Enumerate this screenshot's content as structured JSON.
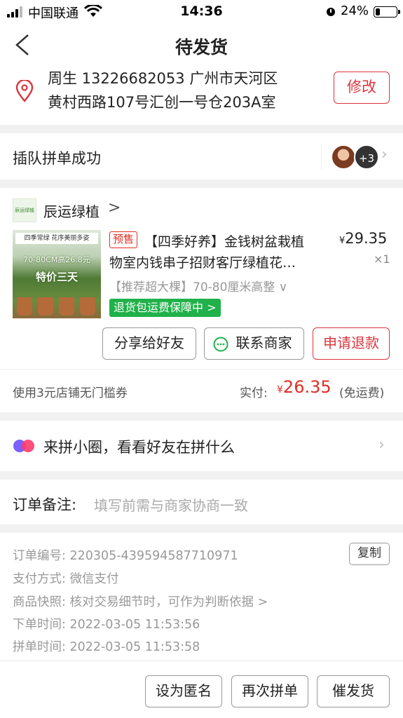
{
  "status_bar": {
    "carrier": "中国联通",
    "time": "14:36",
    "battery_percent": "24%",
    "battery_level": 0.24
  },
  "header": {
    "title": "待发货"
  },
  "address": {
    "name_phone_city": "周生  13226682053  广州市天河区",
    "detail": "黄村西路107号汇创一号仓203A室",
    "modify_label": "修改"
  },
  "group": {
    "label": "插队拼单成功",
    "extra_count": "+3"
  },
  "store": {
    "logo_text": "辰运绿植",
    "name": "辰运绿植",
    "arrow": ">"
  },
  "product": {
    "image_caption_top": "四季常绿  花序美丽多姿",
    "image_caption_mid": "70-80CM高26.8元",
    "image_caption_big": "特价三天",
    "presale_tag": "预售",
    "title_line1": "【四季好养】金钱树盆栽植",
    "title_line2": "物室内钱串子招财客厅绿植花…",
    "currency": "¥",
    "price": "29.35",
    "quantity": "×1",
    "spec": "【推荐超大棵】70-80厘米高整 ∨",
    "guarantee": "退货包运费保障中 >"
  },
  "actions": {
    "share": "分享给好友",
    "contact": "联系商家",
    "refund": "申请退款"
  },
  "payment": {
    "coupon": "使用3元店铺无门槛券",
    "paid_label": "实付:",
    "currency": "¥",
    "paid_amount": "26.35",
    "shipping": "(免运费)"
  },
  "circle": {
    "label": "来拼小圈，看看好友在拼什么"
  },
  "remark": {
    "label": "订单备注:",
    "placeholder": "填写前需与商家协商一致"
  },
  "order_info": {
    "order_no": "订单编号:  220305-439594587710971",
    "copy_label": "复制",
    "pay_method": "支付方式:  微信支付",
    "snapshot": "商品快照:  核对交易细节时，可作为判断依据 >",
    "order_time": "下单时间:  2022-03-05 11:53:56",
    "group_time": "拼单时间:  2022-03-05 11:53:58"
  },
  "bottom_bar": {
    "anonymous": "设为匿名",
    "regroup": "再次拼单",
    "urge": "催发货"
  },
  "colors": {
    "accent_red": "#e02e24",
    "button_red": "#d9363e",
    "guarantee_green": "#20b14a"
  }
}
